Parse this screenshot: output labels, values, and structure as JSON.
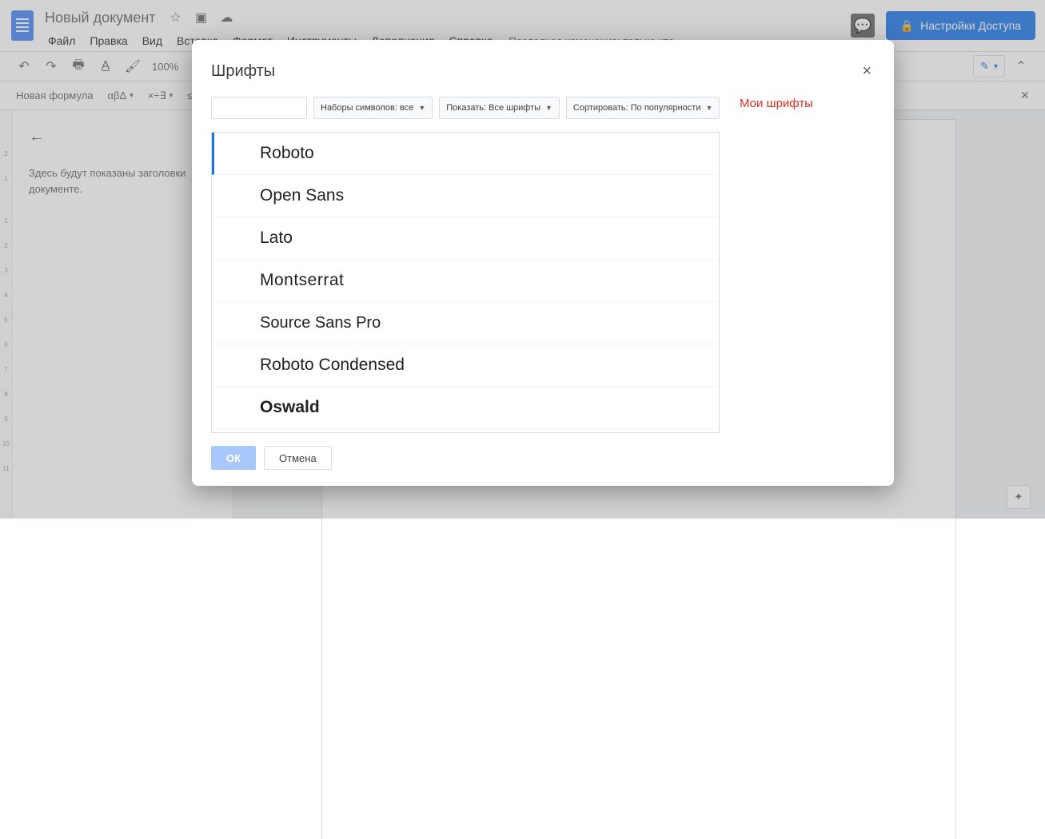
{
  "header": {
    "doc_title": "Новый документ",
    "menus": [
      "Файл",
      "Правка",
      "Вид",
      "Вставка",
      "Формат",
      "Инструменты",
      "Дополнения",
      "Справка"
    ],
    "last_edit": "Последнее изменение: только что",
    "share_label": "Настройки Доступа"
  },
  "toolbar": {
    "zoom": "100%"
  },
  "toolbar2": {
    "formula_label": "Новая формула",
    "chips": [
      "αβΔ",
      "×÷∃",
      "≤≠≥"
    ]
  },
  "outline": {
    "text": "Здесь будут показаны заголовки документе."
  },
  "ruler_v": [
    "2",
    "1",
    "",
    "1",
    "2",
    "3",
    "4",
    "5",
    "6",
    "7",
    "8",
    "9",
    "10",
    "11"
  ],
  "dialog": {
    "title": "Шрифты",
    "search_placeholder": "",
    "filter_scripts": "Наборы символов: все",
    "filter_show": "Показать: Все шрифты",
    "filter_sort": "Сортировать: По популярности",
    "fonts": [
      {
        "name": "Roboto"
      },
      {
        "name": "Open Sans"
      },
      {
        "name": "Lato"
      },
      {
        "name": "Montserrat"
      },
      {
        "name": "Source Sans Pro"
      },
      {
        "name": "Roboto Condensed"
      },
      {
        "name": "Oswald"
      }
    ],
    "selected_index": 0,
    "right_title": "Мои шрифты",
    "ok_label": "ОК",
    "cancel_label": "Отмена"
  }
}
